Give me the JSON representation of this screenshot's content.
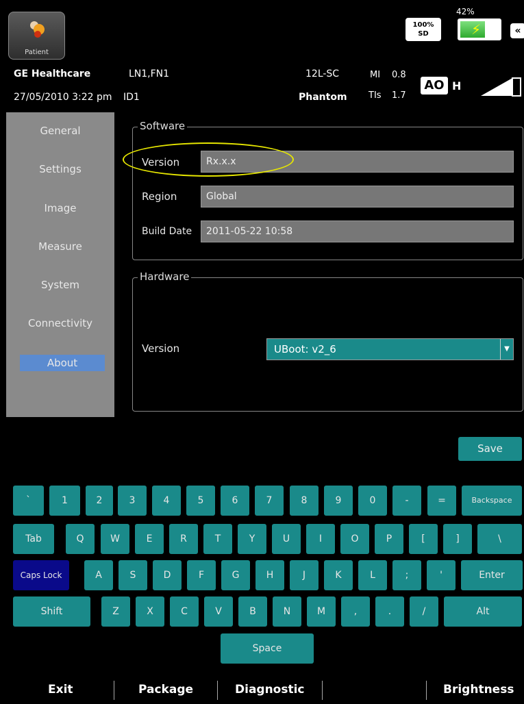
{
  "top": {
    "patient_label": "Patient",
    "brand": "GE Healthcare",
    "patient_name": "LN1,FN1",
    "probe": "12L-SC",
    "mi_label": "MI",
    "mi_value": "0.8",
    "datetime": "27/05/2010  3:22 pm",
    "patient_id": "ID1",
    "preset": "Phantom",
    "tis_label": "TIs",
    "tis_value": "1.7",
    "sd_top": "100%",
    "sd_bottom": "SD",
    "battery_pct": "42%",
    "collapse_glyph": "«",
    "ao_label": "AO",
    "ao_suffix": "H"
  },
  "sidebar": {
    "items": [
      {
        "label": "General"
      },
      {
        "label": "Settings"
      },
      {
        "label": "Image"
      },
      {
        "label": "Measure"
      },
      {
        "label": "System"
      },
      {
        "label": "Connectivity"
      },
      {
        "label": "About"
      }
    ]
  },
  "software": {
    "legend": "Software",
    "version_label": "Version",
    "version_value": "Rx.x.x",
    "region_label": "Region",
    "region_value": "Global",
    "build_label": "Build Date",
    "build_value": "2011-05-22 10:58"
  },
  "hardware": {
    "legend": "Hardware",
    "version_label": "Version",
    "version_value": "UBoot: v2_6"
  },
  "save_label": "Save",
  "keyboard": {
    "row1": [
      "`",
      "1",
      "2",
      "3",
      "4",
      "5",
      "6",
      "7",
      "8",
      "9",
      "0",
      "-",
      "=",
      "Backspace"
    ],
    "row2": [
      "Tab",
      "Q",
      "W",
      "E",
      "R",
      "T",
      "Y",
      "U",
      "I",
      "O",
      "P",
      "[",
      "]",
      "\\"
    ],
    "row3": [
      "Caps Lock",
      "A",
      "S",
      "D",
      "F",
      "G",
      "H",
      "J",
      "K",
      "L",
      ";",
      "'",
      "Enter"
    ],
    "row4": [
      "Shift",
      "Z",
      "X",
      "C",
      "V",
      "B",
      "N",
      "M",
      ",",
      ".",
      "/",
      "Alt"
    ],
    "space": "Space"
  },
  "bottom": {
    "exit": "Exit",
    "package": "Package",
    "diagnostic": "Diagnostic",
    "brightness": "Brightness"
  }
}
